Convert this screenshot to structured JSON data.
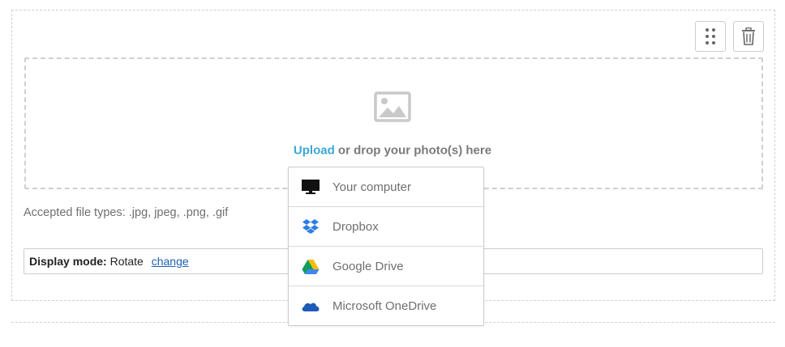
{
  "uploader": {
    "upload_link": "Upload",
    "drop_text": " or drop your photo(s) here",
    "accepted_types": "Accepted file types: .jpg, jpeg, .png, .gif"
  },
  "display_mode": {
    "label": "Display mode:",
    "value": "Rotate",
    "change_link": "change"
  },
  "source_menu": {
    "items": [
      {
        "label": "Your computer",
        "icon": "monitor-icon"
      },
      {
        "label": "Dropbox",
        "icon": "dropbox-icon"
      },
      {
        "label": "Google Drive",
        "icon": "google-drive-icon"
      },
      {
        "label": "Microsoft OneDrive",
        "icon": "onedrive-icon"
      }
    ]
  },
  "colors": {
    "link_blue": "#3aa7d8",
    "change_link": "#1a5fb4",
    "dropbox": "#2d7ee5",
    "onedrive": "#1e5bb8"
  }
}
